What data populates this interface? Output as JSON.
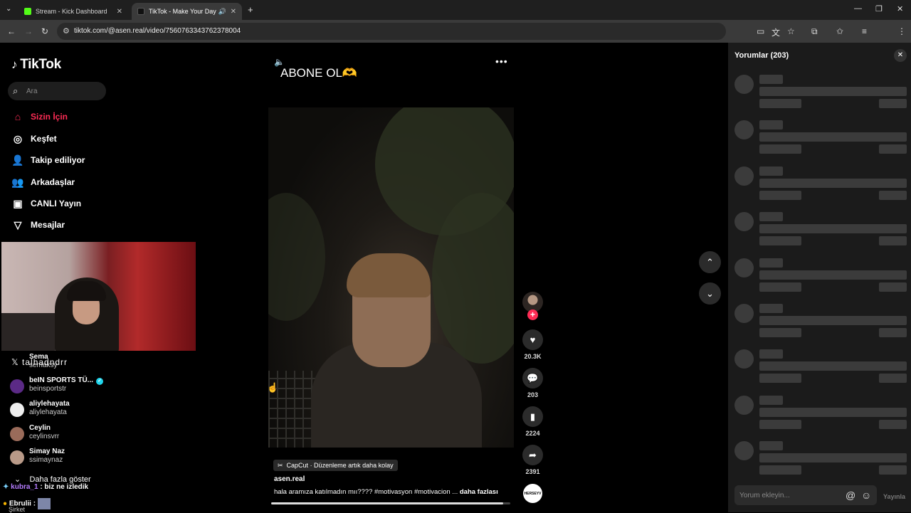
{
  "browser": {
    "tabs": [
      {
        "title": "Stream - Kick Dashboard",
        "favicon_color": "#53fc18"
      },
      {
        "title": "TikTok - Make Your Day",
        "favicon_color": "#111111"
      }
    ],
    "url": "tiktok.com/@asen.real/video/7560763343762378004",
    "profile_initial": "T"
  },
  "sidebar": {
    "logo": "TikTok",
    "search_placeholder": "Ara",
    "nav": [
      {
        "label": "Sizin İçin",
        "icon": "home-icon"
      },
      {
        "label": "Keşfet",
        "icon": "compass-icon"
      },
      {
        "label": "Takip ediliyor",
        "icon": "following-icon"
      },
      {
        "label": "Arkadaşlar",
        "icon": "friends-icon"
      },
      {
        "label": "CANLI Yayın",
        "icon": "live-icon"
      },
      {
        "label": "Mesajlar",
        "icon": "messages-icon"
      }
    ],
    "overlay_name": "talhadndrr",
    "accounts": [
      {
        "name": "Sema",
        "handle": "semaksy"
      },
      {
        "name": "beIN SPORTS TÜ...",
        "handle": "beinsportstr"
      },
      {
        "name": "aliylehayata",
        "handle": "aliylehayata"
      },
      {
        "name": "Ceylin",
        "handle": "ceylinsvrr"
      },
      {
        "name": "Simay Naz",
        "handle": "ssimaynaz"
      }
    ],
    "more_label": "Daha fazla göster"
  },
  "stream_chat": [
    {
      "user": "kubra_1",
      "message": ": biz ne izledik",
      "color": "#b57cff"
    },
    {
      "user": "Ebrulii",
      "message": ":",
      "color": "#ffffff"
    }
  ],
  "stream_chat_extra": "Şirket",
  "video": {
    "title": "ABONE OL🫶",
    "capcut_tag": "CapCut · Düzenleme artık daha kolay",
    "author": "asen.real",
    "description": "hala aramıza katılmadın mıı???? #motivasyon  #motivacion  ...",
    "more": "daha fazlası",
    "progress": 0.97,
    "disc_label": "HERSEYV"
  },
  "actions": {
    "likes": "20.3K",
    "comments": "203",
    "saves": "2224",
    "shares": "2391"
  },
  "comments_panel": {
    "title": "Yorumlar (203)",
    "input_placeholder": "Yorum ekleyin...",
    "post_label": "Yayınla",
    "skeleton_count": 9
  },
  "colors": {
    "accent": "#fe2c55",
    "panel": "#1b1b1b"
  }
}
